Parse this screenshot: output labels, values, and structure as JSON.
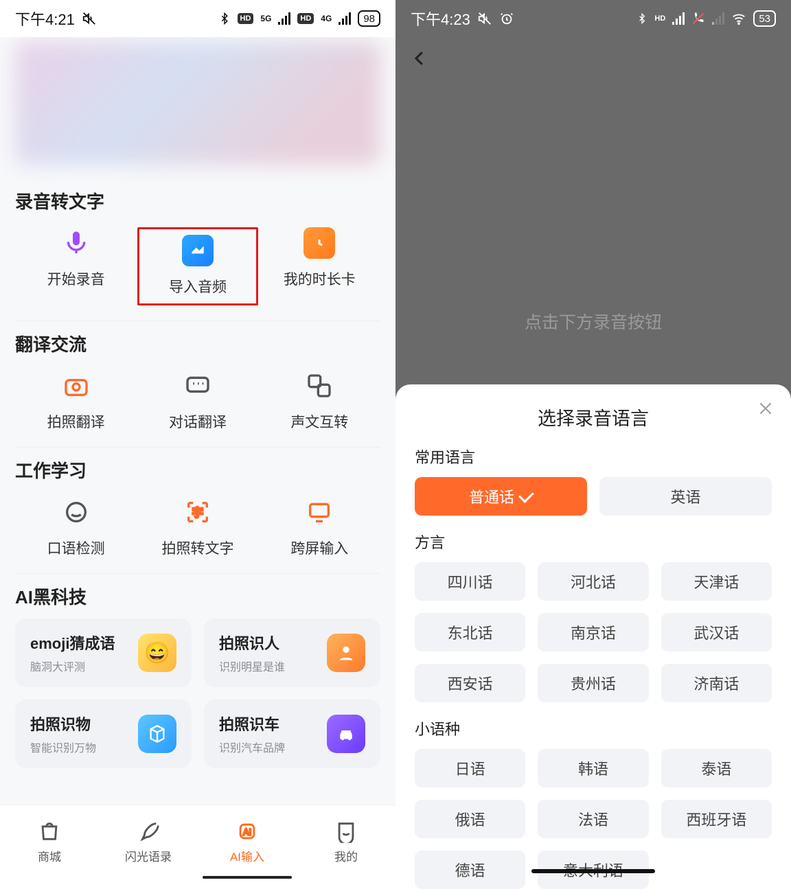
{
  "left": {
    "status": {
      "time": "下午4:21",
      "battery": "98",
      "net1": "5G",
      "net2": "4G"
    },
    "sections": {
      "s1": {
        "title": "录音转文字",
        "items": [
          "开始录音",
          "导入音频",
          "我的时长卡"
        ]
      },
      "s2": {
        "title": "翻译交流",
        "items": [
          "拍照翻译",
          "对话翻译",
          "声文互转"
        ]
      },
      "s3": {
        "title": "工作学习",
        "items": [
          "口语检测",
          "拍照转文字",
          "跨屏输入"
        ]
      },
      "s4": {
        "title": "AI黑科技",
        "cards": [
          {
            "t1": "emoji猜成语",
            "t2": "脑洞大评测"
          },
          {
            "t1": "拍照识人",
            "t2": "识别明星是谁"
          },
          {
            "t1": "拍照识物",
            "t2": "智能识别万物"
          },
          {
            "t1": "拍照识车",
            "t2": "识别汽车品牌"
          }
        ]
      }
    },
    "nav": [
      "商城",
      "闪光语录",
      "AI输入",
      "我的"
    ]
  },
  "right": {
    "status": {
      "time": "下午4:23",
      "battery": "53"
    },
    "hint": "点击下方录音按钮",
    "sheet": {
      "title": "选择录音语言",
      "groups": {
        "common": {
          "label": "常用语言",
          "items": [
            "普通话",
            "英语"
          ]
        },
        "dialect": {
          "label": "方言",
          "items": [
            "四川话",
            "河北话",
            "天津话",
            "东北话",
            "南京话",
            "武汉话",
            "西安话",
            "贵州话",
            "济南话"
          ]
        },
        "minor": {
          "label": "小语种",
          "items": [
            "日语",
            "韩语",
            "泰语",
            "俄语",
            "法语",
            "西班牙语",
            "德语",
            "意大利语"
          ]
        }
      }
    }
  }
}
